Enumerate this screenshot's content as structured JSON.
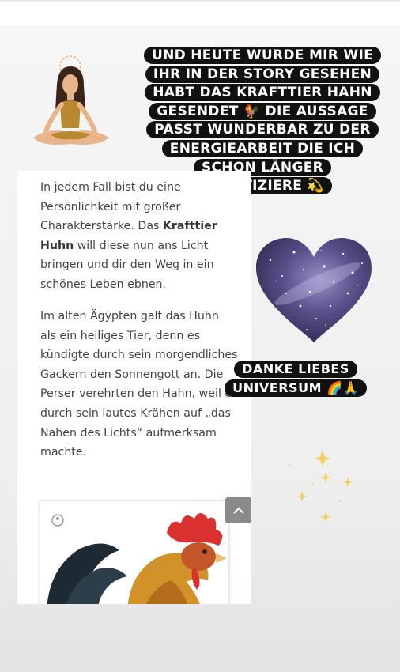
{
  "story": {
    "caption_lines": [
      "UND HEUTE WURDE MIR WIE",
      "IHR IN DER STORY GESEHEN",
      "HABT DAS KRAFTTIER HAHN",
      "GESENDET 🐓 DIE AUSSAGE",
      "PASST WUNDERBAR ZU DER",
      "ENERGIEARBEIT DIE ICH",
      "SCHON LÄNGER",
      "PRAKTIZIERE 💫"
    ],
    "thanks_lines": [
      "DANKE LIEBES",
      "UNIVERSUM 🌈🙏"
    ]
  },
  "article": {
    "p1_text_a": "In jedem Fall bist du eine Persönlichkeit mit großer Charakterstärke. Das ",
    "p1_bold": "Krafttier Huhn",
    "p1_text_b": " will diese nun ans Licht bringen und dir den Weg in ein schönes Leben ebnen.",
    "p2_text": "Im alten Ägypten galt das Huhn als ein heiliges Tier, denn es kündigte durch sein morgendliches Gackern den Sonnengott an. Die Perser verehrten den Hahn, weil er durch sein lautes Krähen auf „das Nahen des Lichts“ aufmerksam machte."
  },
  "icons": {
    "scroll_top": "chevron-up-icon",
    "meditation_sticker": "meditating-woman-icon",
    "galaxy_heart": "heart-icon",
    "sparkles": "sparkle-icon",
    "image_logo": "logo-icon"
  },
  "colors": {
    "caption_bg": "#111111",
    "caption_text": "#ffffff",
    "body_text": "#444444",
    "scroll_button": "#8a8a8a"
  }
}
